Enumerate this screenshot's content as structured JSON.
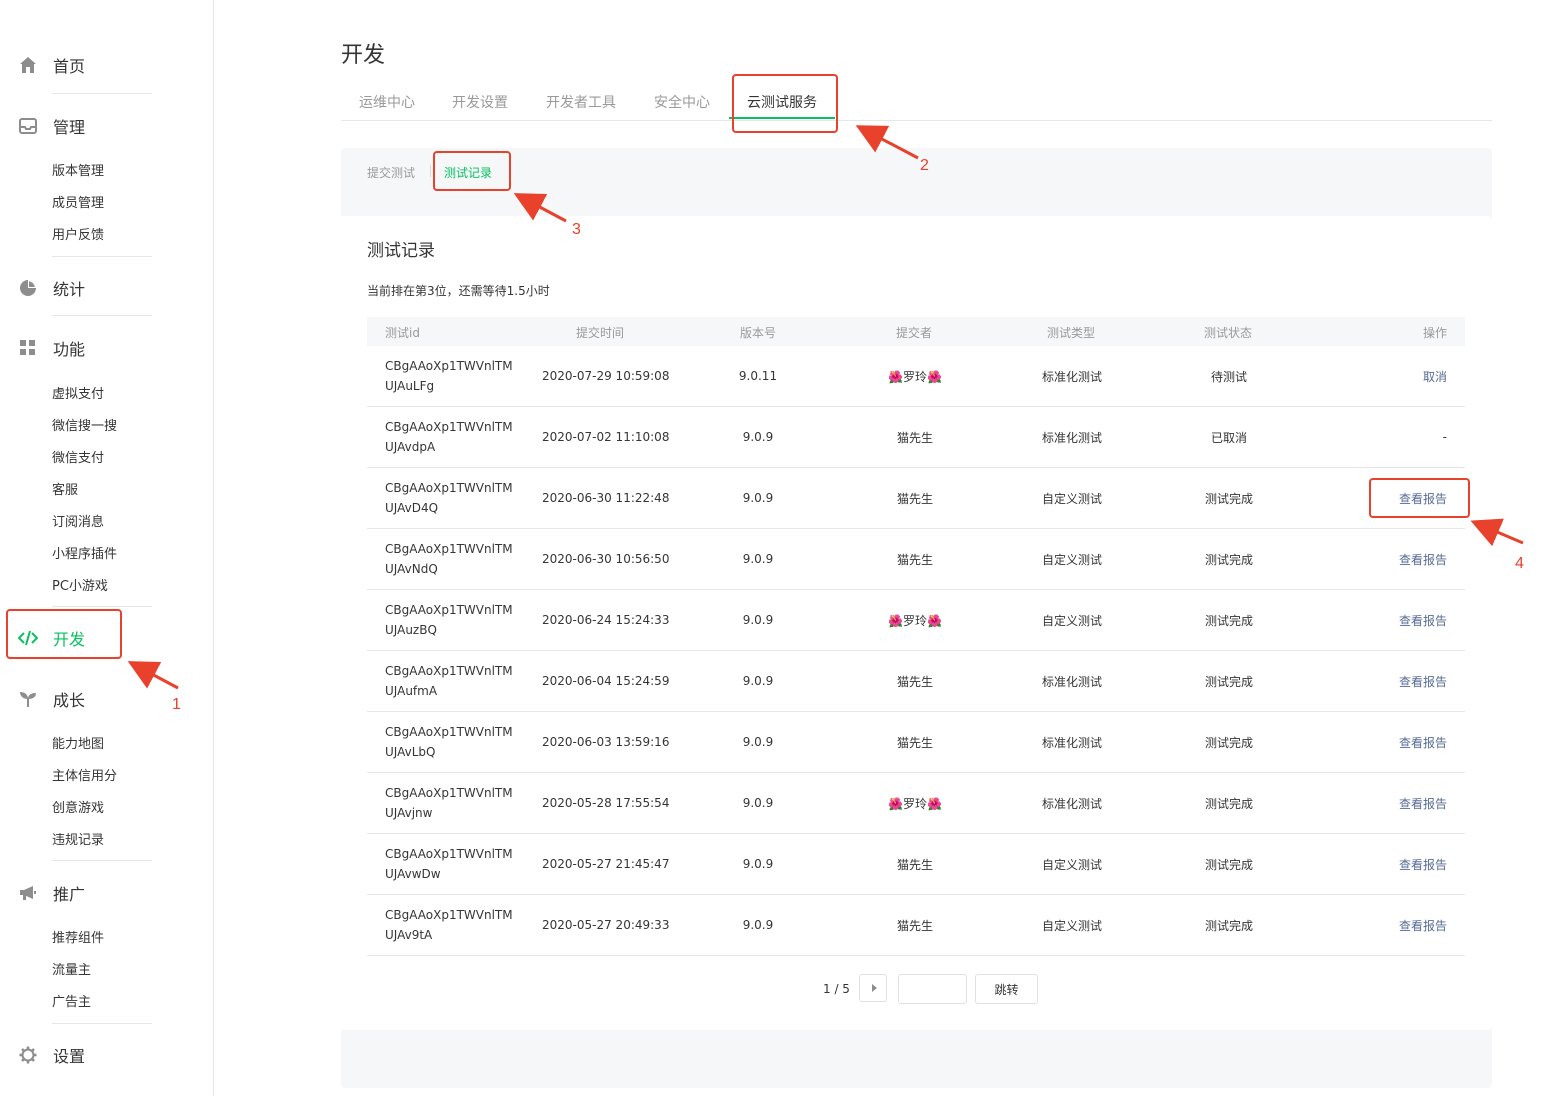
{
  "sidebar": {
    "home": {
      "label": "首页",
      "icon": "home-icon"
    },
    "manage": {
      "label": "管理",
      "icon": "inbox-icon",
      "items": [
        "版本管理",
        "成员管理",
        "用户反馈"
      ]
    },
    "stats": {
      "label": "统计",
      "icon": "pie-chart-icon"
    },
    "features": {
      "label": "功能",
      "icon": "grid-icon",
      "items": [
        "虚拟支付",
        "微信搜一搜",
        "微信支付",
        "客服",
        "订阅消息",
        "小程序插件",
        "PC小游戏"
      ]
    },
    "develop": {
      "label": "开发",
      "icon": "code-icon",
      "active": true
    },
    "growth": {
      "label": "成长",
      "icon": "sprout-icon",
      "items": [
        "能力地图",
        "主体信用分",
        "创意游戏",
        "违规记录"
      ]
    },
    "promote": {
      "label": "推广",
      "icon": "megaphone-icon",
      "items": [
        "推荐组件",
        "流量主",
        "广告主"
      ]
    },
    "settings": {
      "label": "设置",
      "icon": "gear-icon"
    }
  },
  "page": {
    "title": "开发",
    "tabs": [
      "运维中心",
      "开发设置",
      "开发者工具",
      "安全中心",
      "云测试服务"
    ],
    "active_tab": "云测试服务",
    "subtabs": [
      "提交测试",
      "测试记录"
    ],
    "active_subtab": "测试记录"
  },
  "records": {
    "title": "测试记录",
    "queue_note": "当前排在第3位，还需等待1.5小时",
    "columns": [
      "测试id",
      "提交时间",
      "版本号",
      "提交者",
      "测试类型",
      "测试状态",
      "操作"
    ],
    "rows": [
      {
        "id": "CBgAAoXp1TWVnlTM\nUJAuLFg",
        "time": "2020-07-29 10:59:08",
        "version": "9.0.11",
        "submitter": "🌺罗玲🌺",
        "type": "标准化测试",
        "status": "待测试",
        "action": "取消"
      },
      {
        "id": "CBgAAoXp1TWVnlTM\nUJAvdpA",
        "time": "2020-07-02 11:10:08",
        "version": "9.0.9",
        "submitter": "猫先生",
        "type": "标准化测试",
        "status": "已取消",
        "action": "-"
      },
      {
        "id": "CBgAAoXp1TWVnlTM\nUJAvD4Q",
        "time": "2020-06-30 11:22:48",
        "version": "9.0.9",
        "submitter": "猫先生",
        "type": "自定义测试",
        "status": "测试完成",
        "action": "查看报告"
      },
      {
        "id": "CBgAAoXp1TWVnlTM\nUJAvNdQ",
        "time": "2020-06-30 10:56:50",
        "version": "9.0.9",
        "submitter": "猫先生",
        "type": "自定义测试",
        "status": "测试完成",
        "action": "查看报告"
      },
      {
        "id": "CBgAAoXp1TWVnlTM\nUJAuzBQ",
        "time": "2020-06-24 15:24:33",
        "version": "9.0.9",
        "submitter": "🌺罗玲🌺",
        "type": "自定义测试",
        "status": "测试完成",
        "action": "查看报告"
      },
      {
        "id": "CBgAAoXp1TWVnlTM\nUJAufmA",
        "time": "2020-06-04 15:24:59",
        "version": "9.0.9",
        "submitter": "猫先生",
        "type": "标准化测试",
        "status": "测试完成",
        "action": "查看报告"
      },
      {
        "id": "CBgAAoXp1TWVnlTM\nUJAvLbQ",
        "time": "2020-06-03 13:59:16",
        "version": "9.0.9",
        "submitter": "猫先生",
        "type": "标准化测试",
        "status": "测试完成",
        "action": "查看报告"
      },
      {
        "id": "CBgAAoXp1TWVnlTM\nUJAvjnw",
        "time": "2020-05-28 17:55:54",
        "version": "9.0.9",
        "submitter": "🌺罗玲🌺",
        "type": "标准化测试",
        "status": "测试完成",
        "action": "查看报告"
      },
      {
        "id": "CBgAAoXp1TWVnlTM\nUJAvwDw",
        "time": "2020-05-27 21:45:47",
        "version": "9.0.9",
        "submitter": "猫先生",
        "type": "自定义测试",
        "status": "测试完成",
        "action": "查看报告"
      },
      {
        "id": "CBgAAoXp1TWVnlTM\nUJAv9tA",
        "time": "2020-05-27 20:49:33",
        "version": "9.0.9",
        "submitter": "猫先生",
        "type": "自定义测试",
        "status": "测试完成",
        "action": "查看报告"
      }
    ],
    "pagination": {
      "text": "1 / 5",
      "jump_label": "跳转",
      "input_value": ""
    }
  },
  "annotations": {
    "marker_color": "#e8412c",
    "numbers": [
      "1",
      "2",
      "3",
      "4"
    ]
  },
  "colors": {
    "accent": "#07c160",
    "link": "#576b95"
  }
}
